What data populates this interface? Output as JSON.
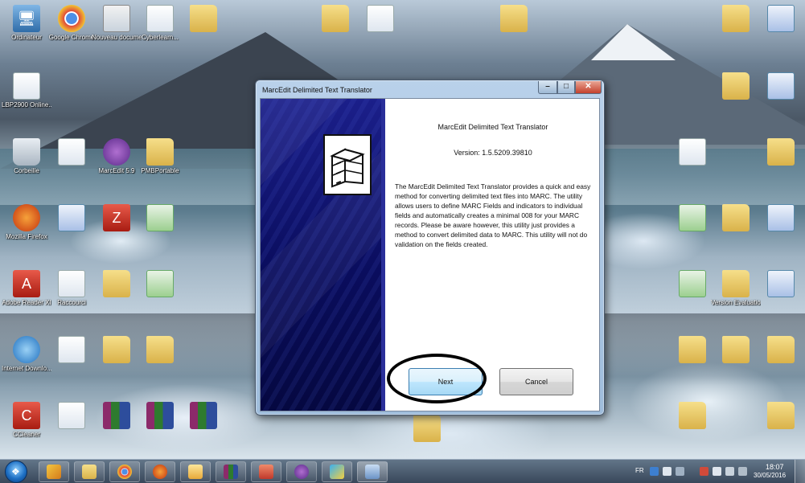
{
  "desktop_icons": [
    {
      "label": "Ordinateur",
      "icon": "computer-icon"
    },
    {
      "label": "Google Chrome",
      "icon": "chrome-icon"
    },
    {
      "label": "Nouveau docume...",
      "icon": "document-icon"
    },
    {
      "label": "Cyberlearn...",
      "icon": "document-icon"
    },
    {
      "label": "LBP2900 Online...",
      "icon": "document-icon"
    },
    {
      "label": "Corbeille",
      "icon": "recycle-bin-icon"
    },
    {
      "label": "MarcEdit 5.9",
      "icon": "marcedit-icon"
    },
    {
      "label": "PMBPortable",
      "icon": "folder-icon"
    },
    {
      "label": "Mozilla Firefox",
      "icon": "firefox-icon"
    },
    {
      "label": "Adobe Reader XI",
      "icon": "acrobat-icon"
    },
    {
      "label": "Raccourci",
      "icon": "document-icon"
    },
    {
      "label": "Internet Downlo...",
      "icon": "ie-icon"
    },
    {
      "label": "CCleaner",
      "icon": "ccleaner-icon"
    },
    {
      "label": "Version Evaluation",
      "icon": "folder-icon"
    }
  ],
  "dialog": {
    "title": "MarcEdit Delimited Text Translator",
    "heading": "MarcEdit Delimited Text Translator",
    "version": "Version: 1.5.5209.39810",
    "description": "The MarcEdit Delimited Text Translator provides a quick and easy method for converting delimited text files into MARC.  The utility allows users to define MARC Fields and indicators to individual fields and automatically creates a minimal 008 for your MARC records.  Please be aware however, this utility just provides a method to convert delimited data to MARC. This utility will not do validation on the fields created.",
    "next_label": "Next",
    "cancel_label": "Cancel"
  },
  "taskbar": {
    "clock_time": "18:07",
    "clock_date": "30/05/2016",
    "language": "FR"
  },
  "colors": {
    "side_panel": "#0a0d5e",
    "annotation": "#000000",
    "close_button": "#c4402c"
  }
}
